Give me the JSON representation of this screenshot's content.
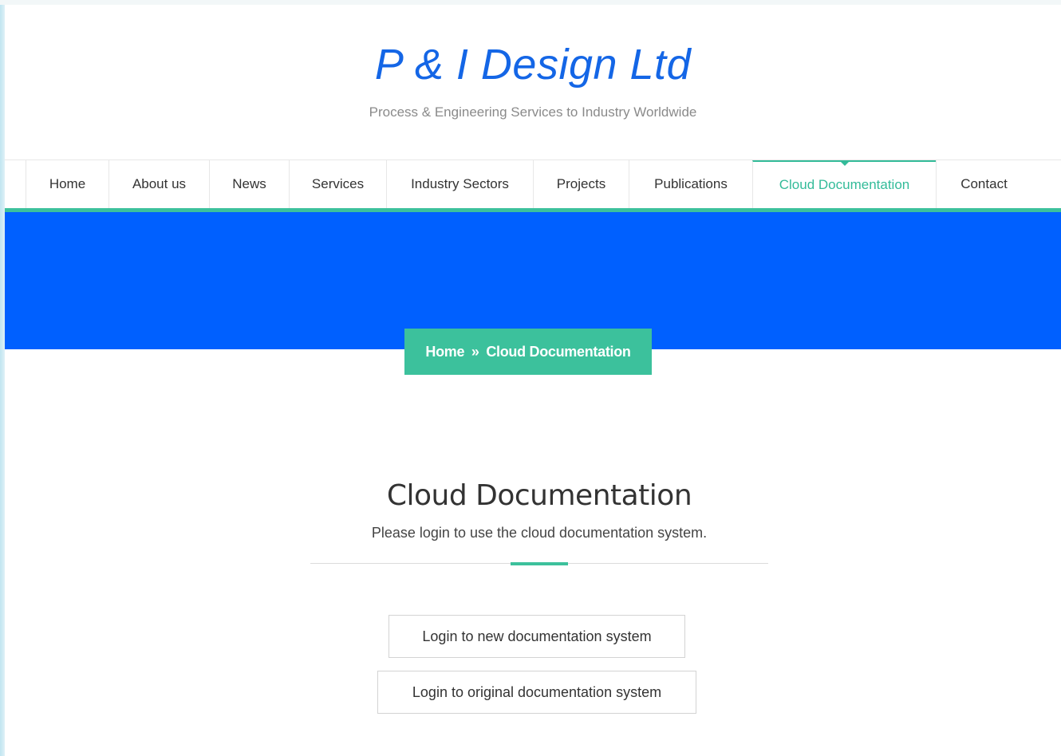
{
  "site": {
    "title": "P & I Design Ltd",
    "tagline": "Process & Engineering Services to Industry Worldwide"
  },
  "nav": {
    "items": [
      {
        "label": "Home"
      },
      {
        "label": "About us"
      },
      {
        "label": "News"
      },
      {
        "label": "Services"
      },
      {
        "label": "Industry Sectors"
      },
      {
        "label": "Projects"
      },
      {
        "label": "Publications"
      },
      {
        "label": "Cloud Documentation",
        "active": true
      },
      {
        "label": "Contact"
      }
    ]
  },
  "breadcrumb": {
    "home": "Home",
    "separator": "»",
    "current": "Cloud Documentation"
  },
  "content": {
    "title": "Cloud Documentation",
    "subtitle": "Please login to use the cloud documentation system.",
    "buttons": {
      "new_system": "Login to new documentation system",
      "original_system": "Login to original documentation system"
    }
  },
  "colors": {
    "accent": "#3cc19c",
    "hero": "#0060ff",
    "logo": "#1466e6"
  }
}
